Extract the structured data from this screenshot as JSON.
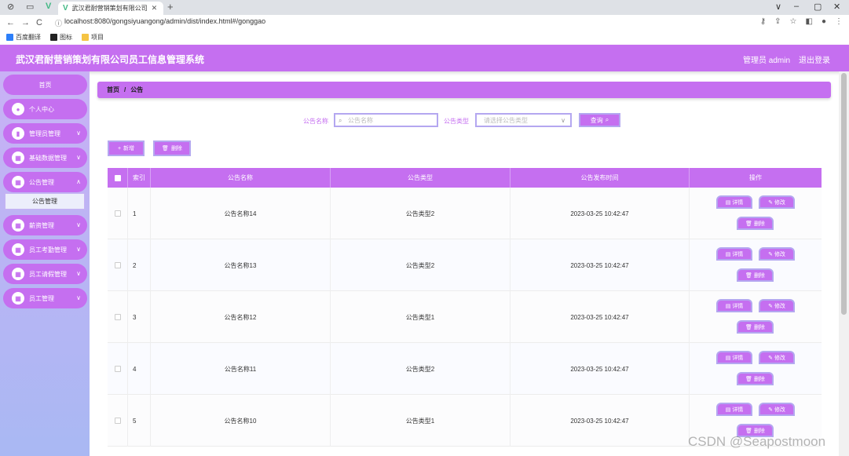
{
  "browser": {
    "tab_title": "武汉君耐营销策划有限公司员工信",
    "address": "localhost:8080/gongsiyuangong/admin/dist/index.html#/gonggao",
    "bookmarks": [
      "百度翻译",
      "图标",
      "项目"
    ]
  },
  "header": {
    "title": "武汉君耐营销策划有限公司员工信息管理系统",
    "user": "管理员 admin",
    "logout": "退出登录"
  },
  "sidebar": {
    "items": [
      {
        "label": "首页"
      },
      {
        "label": "个人中心"
      },
      {
        "label": "管理员管理"
      },
      {
        "label": "基础数据管理"
      },
      {
        "label": "公告管理"
      },
      {
        "label": "薪资管理"
      },
      {
        "label": "员工考勤管理"
      },
      {
        "label": "员工请假管理"
      },
      {
        "label": "员工管理"
      }
    ],
    "sub_item": "公告管理"
  },
  "breadcrumb": {
    "home": "首页",
    "sep": "/",
    "current": "公告"
  },
  "search": {
    "name_label": "公告名称",
    "name_placeholder": "公告名称",
    "type_label": "公告类型",
    "type_placeholder": "请选择公告类型",
    "query": "查询"
  },
  "actions": {
    "add": "新增",
    "delete": "删除"
  },
  "table": {
    "headers": [
      "索引",
      "公告名称",
      "公告类型",
      "公告发布时间",
      "操作"
    ],
    "rows": [
      {
        "index": "1",
        "name": "公告名称14",
        "type": "公告类型2",
        "time": "2023-03-25 10:42:47"
      },
      {
        "index": "2",
        "name": "公告名称13",
        "type": "公告类型2",
        "time": "2023-03-25 10:42:47"
      },
      {
        "index": "3",
        "name": "公告名称12",
        "type": "公告类型1",
        "time": "2023-03-25 10:42:47"
      },
      {
        "index": "4",
        "name": "公告名称11",
        "type": "公告类型2",
        "time": "2023-03-25 10:42:47"
      },
      {
        "index": "5",
        "name": "公告名称10",
        "type": "公告类型1",
        "time": "2023-03-25 10:42:47"
      }
    ],
    "row_actions": {
      "detail": "详情",
      "edit": "修改",
      "delete": "删除"
    }
  },
  "watermark": "CSDN @Seapostmoon",
  "colors": {
    "accent": "#c56ff0",
    "border": "#b4a7f0",
    "sidebar_bg": "#b6b6f4"
  }
}
